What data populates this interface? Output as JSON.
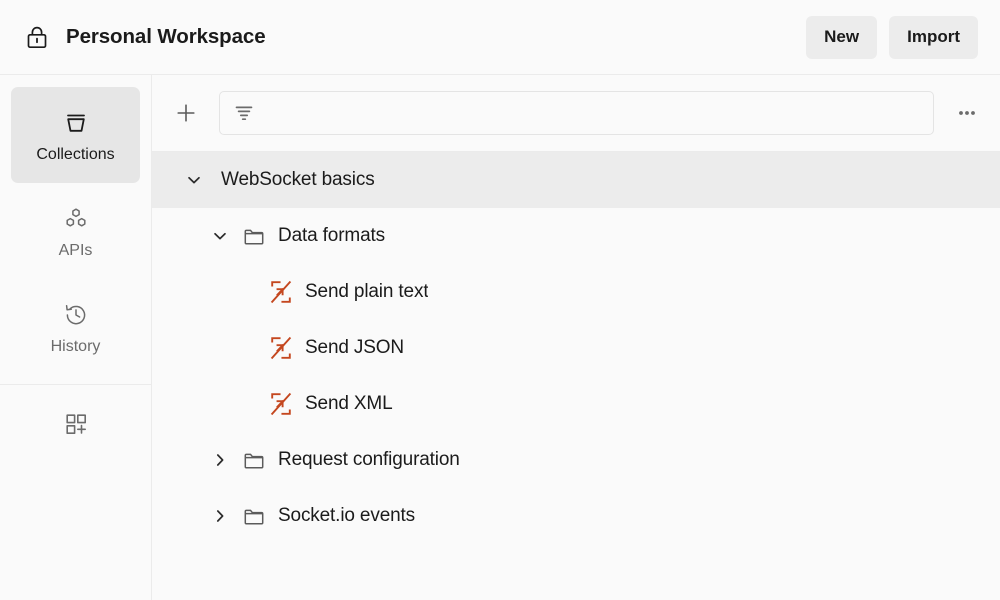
{
  "header": {
    "lock_icon": "lock-icon",
    "workspace_title": "Personal Workspace",
    "buttons": [
      {
        "label": "New",
        "name": "new-button"
      },
      {
        "label": "Import",
        "name": "import-button"
      }
    ]
  },
  "sidebar": {
    "items": [
      {
        "label": "Collections",
        "icon": "collections-icon",
        "active": true
      },
      {
        "label": "APIs",
        "icon": "apis-icon",
        "active": false
      },
      {
        "label": "History",
        "icon": "history-icon",
        "active": false
      }
    ],
    "add_apps": {
      "icon": "add-apps-icon",
      "label": ""
    }
  },
  "toolbar": {
    "add_icon": "plus-icon",
    "filter_icon": "filter-icon",
    "search_value": "",
    "search_placeholder": "",
    "more_icon": "ellipsis-icon"
  },
  "tree": {
    "items": [
      {
        "label": "WebSocket basics",
        "type": "collection",
        "depth": 0,
        "expanded": true,
        "selected": true,
        "icon": "none"
      },
      {
        "label": "Data formats",
        "type": "folder",
        "depth": 1,
        "expanded": true,
        "selected": false,
        "icon": "folder-icon"
      },
      {
        "label": "Send plain text",
        "type": "request",
        "depth": 2,
        "expanded": null,
        "selected": false,
        "icon": "websocket-icon"
      },
      {
        "label": "Send JSON",
        "type": "request",
        "depth": 2,
        "expanded": null,
        "selected": false,
        "icon": "websocket-icon"
      },
      {
        "label": "Send XML",
        "type": "request",
        "depth": 2,
        "expanded": null,
        "selected": false,
        "icon": "websocket-icon"
      },
      {
        "label": "Request configuration",
        "type": "folder",
        "depth": 1,
        "expanded": false,
        "selected": false,
        "icon": "folder-icon"
      },
      {
        "label": "Socket.io events",
        "type": "folder",
        "depth": 1,
        "expanded": false,
        "selected": false,
        "icon": "folder-icon"
      }
    ]
  },
  "colors": {
    "websocket_accent": "#c4471f",
    "selected_row": "#ececec",
    "panel_bg": "#fafafa",
    "button_bg": "#ececec",
    "border": "#ebebeb",
    "text": "#1b1b1b",
    "muted_text": "#6b6b6b"
  }
}
